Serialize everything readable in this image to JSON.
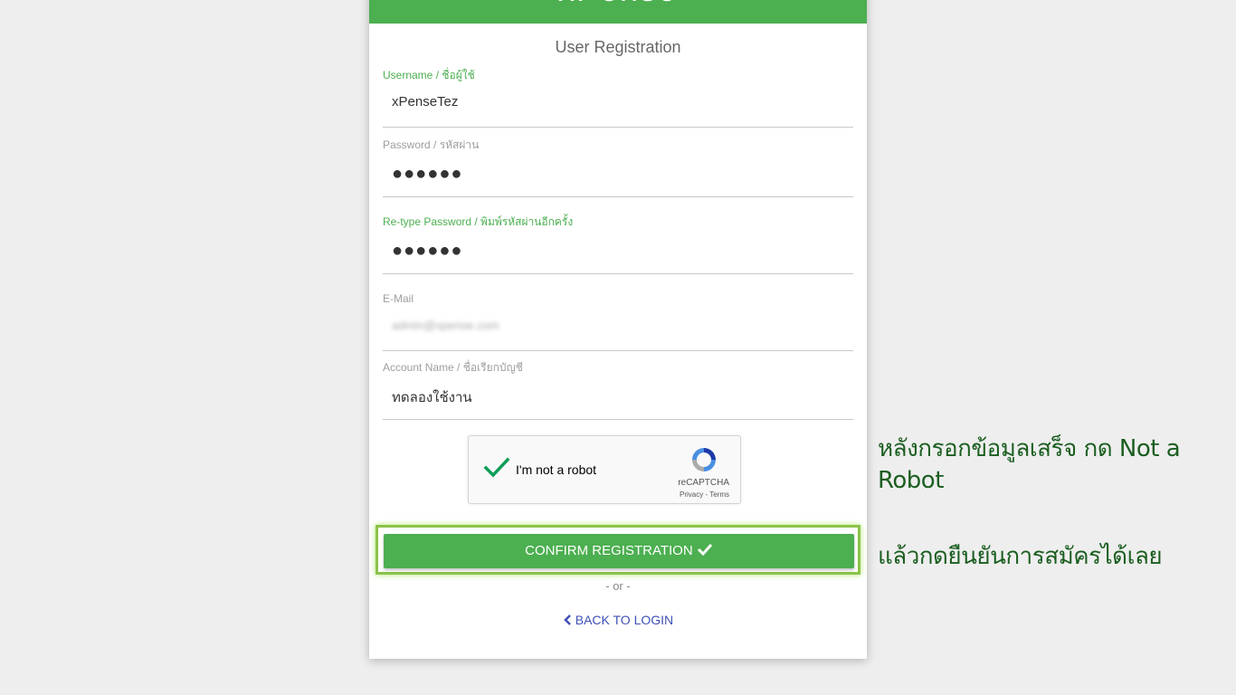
{
  "app": {
    "brand": "xPense"
  },
  "form": {
    "title": "User Registration",
    "username": {
      "label": "Username / ชื่อผู้ใช้",
      "value": "xPenseTez"
    },
    "password": {
      "label": "Password / รหัสผ่าน",
      "value": "●●●●●●"
    },
    "retype": {
      "label": "Re-type Password / พิมพ์รหัสผ่านอีกครั้ง",
      "value": "●●●●●●"
    },
    "email": {
      "label": "E-Mail",
      "value": "admin@xpense.com"
    },
    "account": {
      "label": "Account Name / ชื่อเรียกบัญชี",
      "value": "ทดลองใช้งาน"
    }
  },
  "recaptcha": {
    "label": "I'm not a robot",
    "brand": "reCAPTCHA",
    "links": "Privacy - Terms"
  },
  "actions": {
    "confirm_label": "CONFIRM REGISTRATION",
    "or_text": "- or -",
    "back_label": "BACK TO LOGIN"
  },
  "annotations": {
    "note1": "หลังกรอกข้อมูลเสร็จ กด Not a Robot",
    "note2": "แล้วกดยืนยันการสมัครได้เลย"
  },
  "colors": {
    "accent": "#4caf50",
    "highlight": "#8bc34a",
    "link": "#3f51b5",
    "note": "#1b5e20"
  }
}
